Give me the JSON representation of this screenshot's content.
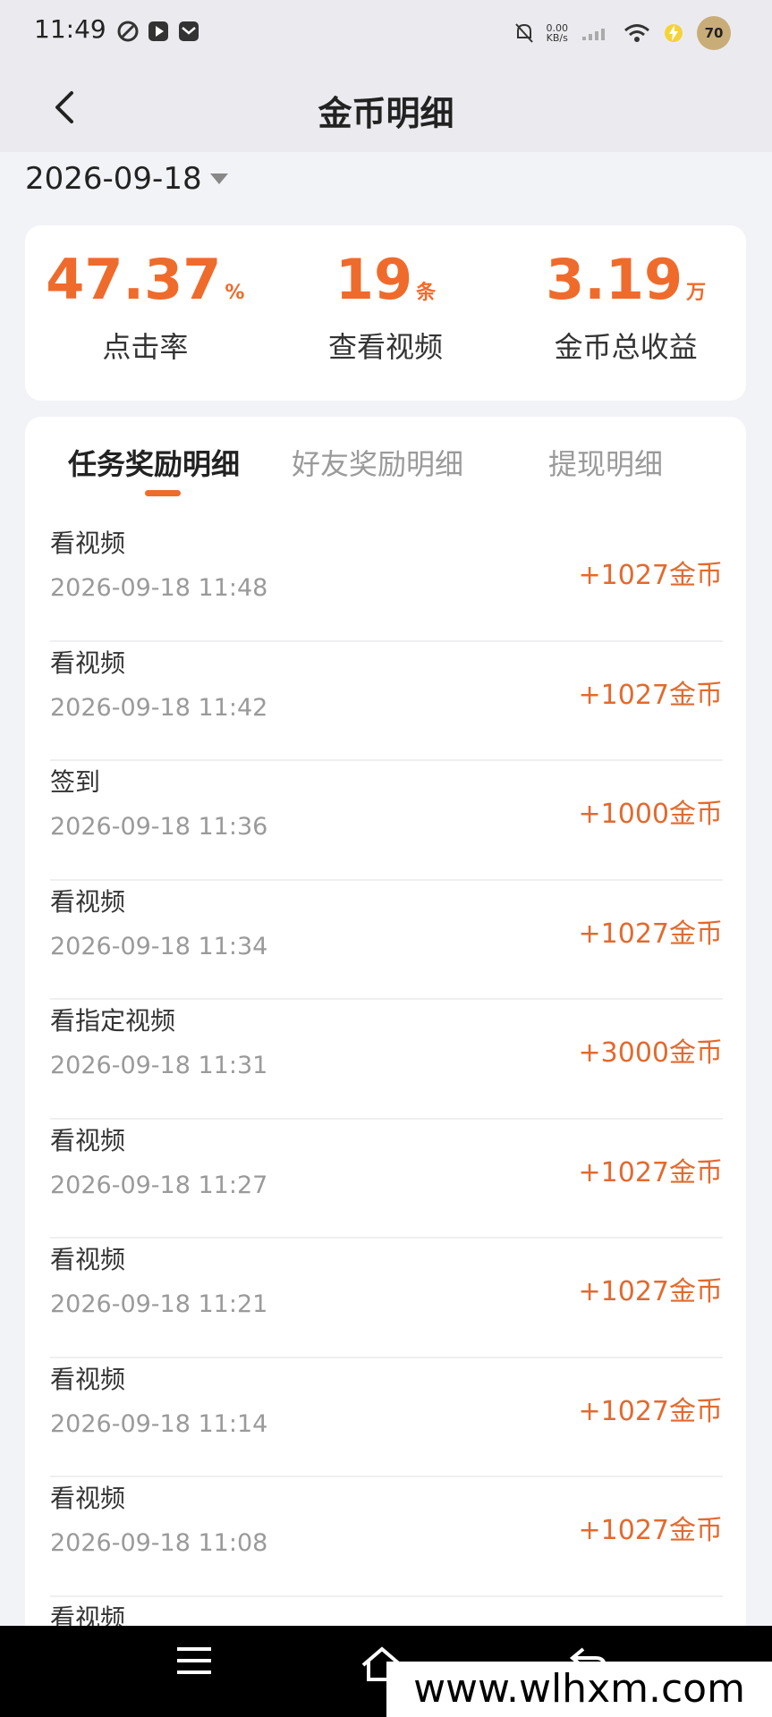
{
  "status_bar": {
    "time": "11:49",
    "net_speed_value": "0.00",
    "net_speed_unit": "KB/s",
    "battery": "70",
    "icons": [
      "app-icon-1",
      "play-icon",
      "mail-icon",
      "mute-icon",
      "signal-icon",
      "wifi-icon",
      "charging-icon"
    ]
  },
  "header": {
    "title": "金币明细"
  },
  "date_selector": {
    "value": "2026-09-18"
  },
  "stats": [
    {
      "value": "47.37",
      "unit": "%",
      "label": "点击率"
    },
    {
      "value": "19",
      "unit": "条",
      "label": "查看视频"
    },
    {
      "value": "3.19",
      "unit": "万",
      "label": "金币总收益"
    }
  ],
  "tabs": [
    {
      "label": "任务奖励明细",
      "active": true
    },
    {
      "label": "好友奖励明细",
      "active": false
    },
    {
      "label": "提现明细",
      "active": false
    }
  ],
  "records": [
    {
      "title": "看视频",
      "time": "2026-09-18 11:48",
      "amount": "+1027金币"
    },
    {
      "title": "看视频",
      "time": "2026-09-18 11:42",
      "amount": "+1027金币"
    },
    {
      "title": "签到",
      "time": "2026-09-18 11:36",
      "amount": "+1000金币"
    },
    {
      "title": "看视频",
      "time": "2026-09-18 11:34",
      "amount": "+1027金币"
    },
    {
      "title": "看指定视频",
      "time": "2026-09-18 11:31",
      "amount": "+3000金币"
    },
    {
      "title": "看视频",
      "time": "2026-09-18 11:27",
      "amount": "+1027金币"
    },
    {
      "title": "看视频",
      "time": "2026-09-18 11:21",
      "amount": "+1027金币"
    },
    {
      "title": "看视频",
      "time": "2026-09-18 11:14",
      "amount": "+1027金币"
    },
    {
      "title": "看视频",
      "time": "2026-09-18 11:08",
      "amount": "+1027金币"
    },
    {
      "title": "看视频",
      "time": "",
      "amount": ""
    }
  ],
  "watermark": "www.wlhxm.com",
  "colors": {
    "accent": "#ef6b2c",
    "background": "#f2f3f7",
    "card": "#ffffff",
    "muted_text": "#9a9a9a"
  }
}
